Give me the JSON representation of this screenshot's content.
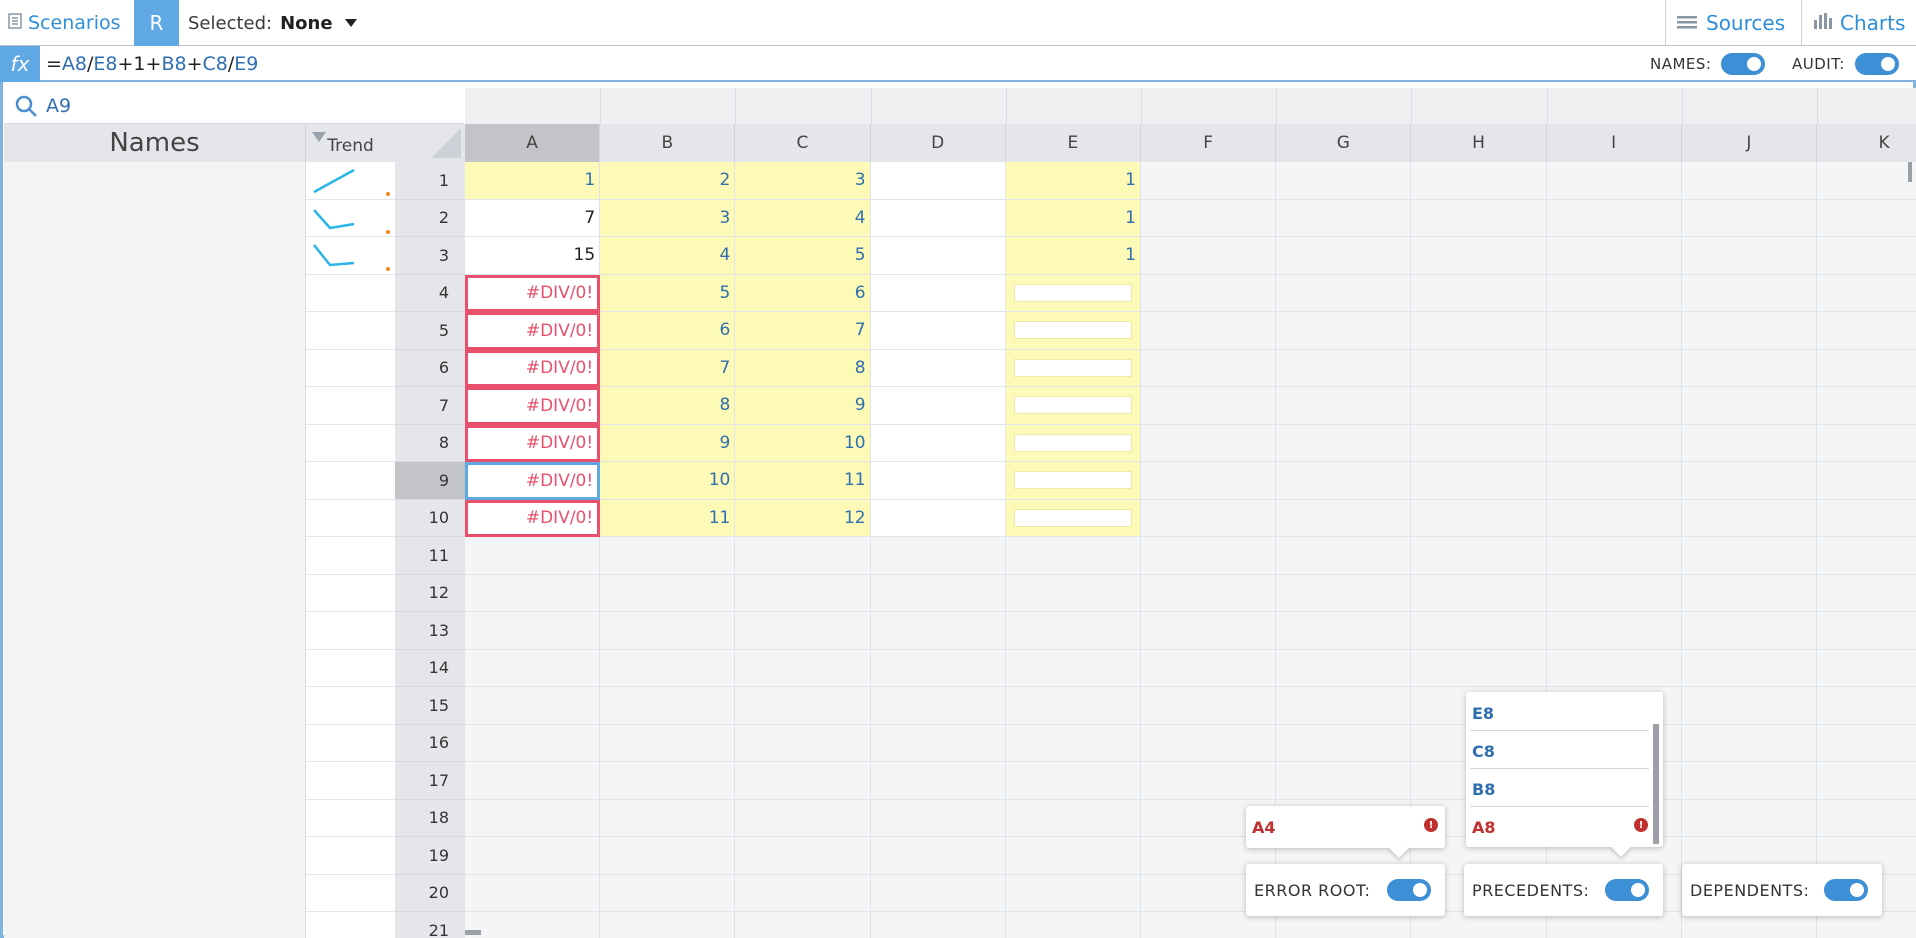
{
  "topbar": {
    "scenarios_label": "Scenarios",
    "r_label": "R",
    "selected_label": "Selected:",
    "selected_value": "None",
    "sources_label": "Sources",
    "charts_label": "Charts"
  },
  "formula_bar": {
    "fx_label": "fx",
    "formula_parts": [
      "=",
      "A8",
      "/",
      "E8",
      "+1+",
      "B8",
      "+",
      "C8",
      "/",
      "E9"
    ],
    "names_label": "NAMES:",
    "audit_label": "AUDIT:"
  },
  "search": {
    "value": "A9"
  },
  "names_panel": {
    "header": "Names",
    "trend_header": "Trend"
  },
  "columns": [
    "A",
    "B",
    "C",
    "D",
    "E",
    "F",
    "G",
    "H",
    "I",
    "J",
    "K"
  ],
  "selected_column": "A",
  "selected_row": "9",
  "rows": [
    "1",
    "2",
    "3",
    "4",
    "5",
    "6",
    "7",
    "8",
    "9",
    "10",
    "11",
    "12",
    "13",
    "14",
    "15",
    "16",
    "17",
    "18",
    "19",
    "20",
    "21"
  ],
  "cells": {
    "A": [
      "1",
      "7",
      "15",
      "#DIV/0!",
      "#DIV/0!",
      "#DIV/0!",
      "#DIV/0!",
      "#DIV/0!",
      "#DIV/0!",
      "#DIV/0!"
    ],
    "B": [
      "2",
      "3",
      "4",
      "5",
      "6",
      "7",
      "8",
      "9",
      "10",
      "11"
    ],
    "C": [
      "3",
      "4",
      "5",
      "6",
      "7",
      "8",
      "9",
      "10",
      "11",
      "12"
    ],
    "E": [
      "1",
      "1",
      "1"
    ]
  },
  "audit": {
    "error_root_items": [
      "A4"
    ],
    "precedent_items": [
      "E8",
      "C8",
      "B8",
      "A8"
    ],
    "error_root_label": "ERROR ROOT:",
    "precedents_label": "PRECEDENTS:",
    "dependents_label": "DEPENDENTS:"
  },
  "colors": {
    "accent": "#5fa8e3",
    "link": "#2f8fd8",
    "error": "#e8506d",
    "input_fill": "#fdfab8",
    "trend_line": "#2cb5e8",
    "trend_dot": "#f08a1c"
  },
  "icons": {
    "scenarios": "scenarios-icon",
    "sources": "sources-list-icon",
    "charts": "bar-chart-icon",
    "search": "search-icon",
    "error_info": "info-icon"
  }
}
